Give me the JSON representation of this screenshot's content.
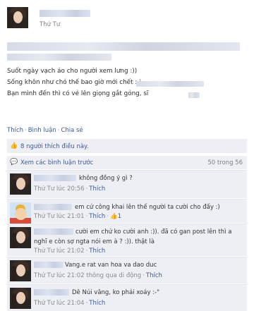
{
  "post": {
    "time": "Thứ Tư",
    "lines": [
      "Suốt ngày vạch áo cho người xem lưng :))",
      "Sống khôn như chó thế bao giờ mới chết :-j",
      "Bạn mình đến thì có vẻ lên giọng gắt gỏng, sĩ"
    ]
  },
  "actions": {
    "like": "Thích",
    "comment": "Bình luận",
    "share": "Chia sẻ"
  },
  "likes": {
    "icon": "thumbs-up-icon",
    "text": "8 người thích điều này."
  },
  "view_more": {
    "icon": "comment-bubble-icon",
    "text": "Xem các bình luận trước",
    "count": "50 trong 56"
  },
  "comments": [
    {
      "text": "không đồng ý gì ?",
      "time": "Thứ Tư lúc 20:56",
      "like": "Thích"
    },
    {
      "text": "em cứ công khai lên thế người ta cười cho đấy :)",
      "time": "Thứ Tư lúc 21:01",
      "like": "Thích",
      "like_count": "1"
    },
    {
      "text": "cười em chứ ko cười anh :)). đã có gan post lên thì a",
      "text2": "nghĩ e còn sợ ngta nói em à ? :)). thật là",
      "time": "Thứ Tư lúc 21:02",
      "like": "Thích"
    },
    {
      "text": "Vang.e rat van hoa va dao duc",
      "time": "Thứ Tư lúc 21:02 thông qua di động",
      "like": "Thích"
    },
    {
      "text": "Dê Núi vâng, ko phải xoáy :-\"",
      "time": "Thứ Tư lúc 21:04",
      "like": "Thích"
    }
  ]
}
